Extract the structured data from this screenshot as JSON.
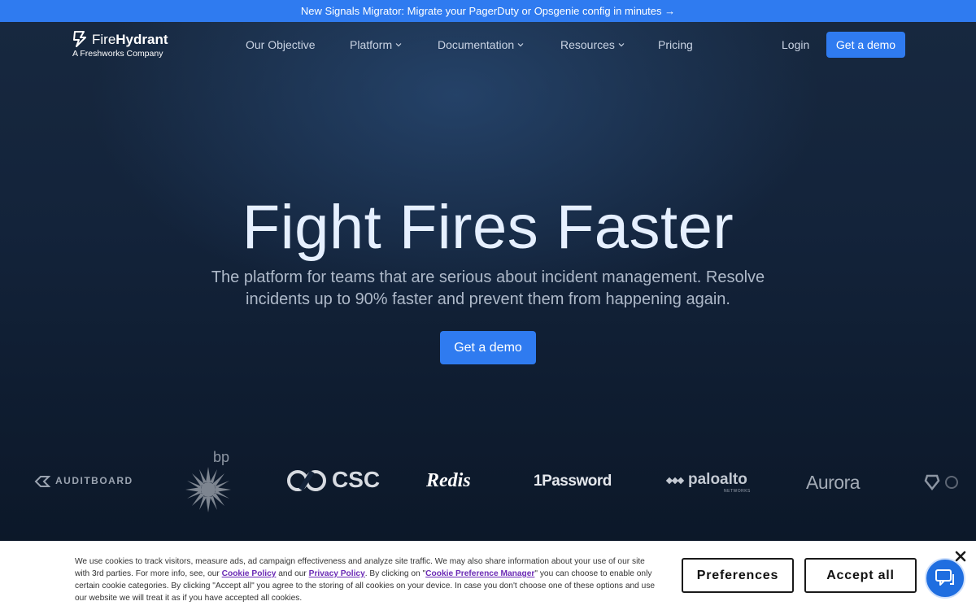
{
  "announcement": {
    "text": "New Signals Migrator: Migrate your PagerDuty or Opsgenie config in minutes →"
  },
  "brand": {
    "name_light": "Fire",
    "name_bold": "Hydrant",
    "subtitle": "A Freshworks Company"
  },
  "nav": {
    "links": [
      {
        "label": "Our Objective"
      },
      {
        "label": "Platform"
      },
      {
        "label": "Documentation"
      },
      {
        "label": "Resources"
      },
      {
        "label": "Pricing"
      }
    ],
    "login_label": "Login",
    "cta_label": "Get a demo"
  },
  "hero": {
    "title": "Fight Fires Faster",
    "subtitle": "The platform for teams that are serious about incident management. Resolve incidents up to 90% faster and prevent them from happening again.",
    "cta_label": "Get a demo"
  },
  "clients": [
    "AUDITBOARD",
    "bp",
    "CSC",
    "Redis",
    "1Password",
    "paloalto",
    "NETWORKS",
    "Aurora"
  ],
  "cookie": {
    "text_1": "We use cookies to track visitors, measure ads, ad campaign effectiveness and analyze site traffic. We may also share information about your use of our site with 3rd parties. For more info, see, our ",
    "cookie_policy": "Cookie Policy",
    "text_2": " and our ",
    "privacy_policy": "Privacy Policy",
    "text_3": ". By clicking on \"",
    "preference_manager": "Cookie Preference Manager",
    "text_4": "\" you can choose to enable only certain cookie categories. By clicking \"Accept all\" you agree to the storing of all cookies on your device. In case you don't choose one of these options and use our website we will treat it as if you have accepted all cookies.",
    "preferences_label": "Preferences",
    "accept_label": "Accept all"
  },
  "colors": {
    "accent": "#2f7bf0",
    "hero_bg": "#13233a",
    "link": "#6b2bb5"
  }
}
